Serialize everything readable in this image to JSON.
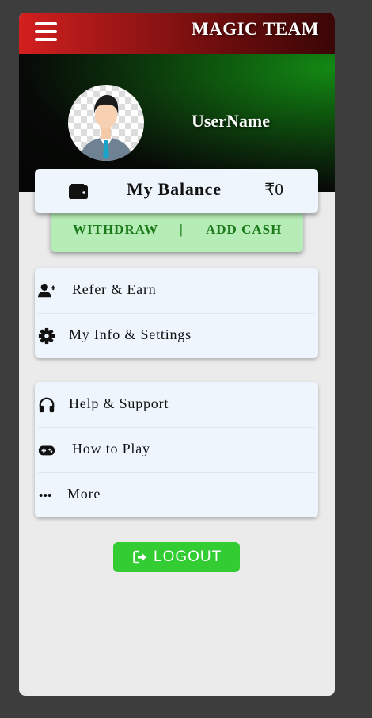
{
  "header": {
    "title": "MAGIC TEAM",
    "menu_icon": "hamburger-menu-icon",
    "gradient_colors": [
      "#d41f1f",
      "#3a0606"
    ]
  },
  "profile": {
    "username": "UserName",
    "avatar_icon": "user-avatar",
    "background_accent": "#138a13"
  },
  "balance": {
    "icon": "wallet-icon",
    "label": "My Balance",
    "value": "₹0"
  },
  "cash_actions": {
    "withdraw_label": "WITHDRAW",
    "separator": "|",
    "add_cash_label": "ADD CASH",
    "color": "#1a7a1a",
    "background": "#b6ecb6"
  },
  "menu_group_1": [
    {
      "label": "Refer & Earn",
      "icon": "user-plus-icon"
    },
    {
      "label": "My Info & Settings",
      "icon": "gear-icon"
    }
  ],
  "menu_group_2": [
    {
      "label": "Help & Support",
      "icon": "headphones-icon"
    },
    {
      "label": "How to Play",
      "icon": "gamepad-icon"
    },
    {
      "label": "More",
      "icon": "ellipsis-icon"
    }
  ],
  "logout": {
    "label": "LOGOUT",
    "icon": "sign-out-icon",
    "color": "#33cc33"
  }
}
